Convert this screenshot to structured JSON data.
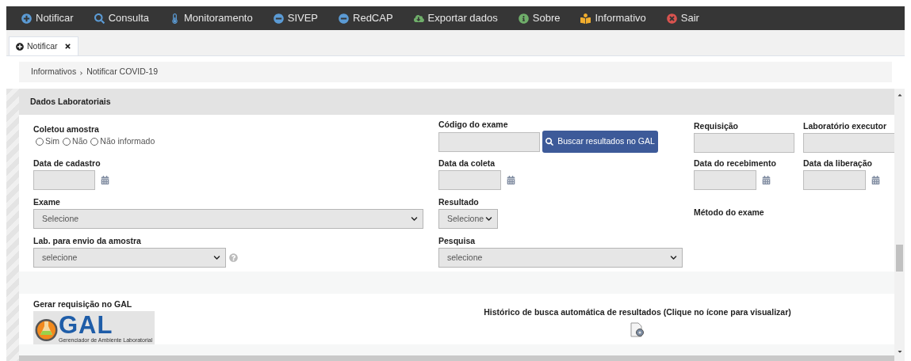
{
  "nav": [
    {
      "label": "Notificar"
    },
    {
      "label": "Consulta"
    },
    {
      "label": "Monitoramento"
    },
    {
      "label": "SIVEP"
    },
    {
      "label": "RedCAP"
    },
    {
      "label": "Exportar dados"
    },
    {
      "label": "Sobre"
    },
    {
      "label": "Informativo"
    },
    {
      "label": "Sair"
    }
  ],
  "tabs": [
    {
      "label": "Notificar",
      "selected": true
    }
  ],
  "breadcrumb": [
    "Informativos",
    "Notificar COVID-19"
  ],
  "section": {
    "title": "Dados Laboratoriais",
    "fields": [
      {
        "kind": "radio",
        "label": "Coletou amostra",
        "options": [
          {
            "label": "Sim",
            "selected": false
          },
          {
            "label": "Não",
            "selected": false
          },
          {
            "label": "Não informado",
            "selected": false
          }
        ]
      },
      {
        "kind": "text_button",
        "label": "Código do exame",
        "button": "Buscar resultados no GAL"
      },
      {
        "kind": "text",
        "label": "Requisição"
      },
      {
        "kind": "text",
        "label": "Laboratório executor"
      },
      {
        "kind": "date",
        "label": "Data de cadastro"
      },
      {
        "kind": "date",
        "label": "Data da coleta"
      },
      {
        "kind": "date",
        "label": "Data do recebimento"
      },
      {
        "kind": "date",
        "label": "Data da liberação"
      },
      {
        "kind": "select",
        "label": "Exame",
        "value": "Selecione"
      },
      {
        "kind": "select",
        "label": "Resultado",
        "value": "Selecione"
      },
      {
        "kind": "label",
        "label": "Método do exame"
      },
      {
        "kind": "blank"
      },
      {
        "kind": "select_help",
        "label": "Lab. para envio da amostra",
        "value": "selecione"
      },
      {
        "kind": "select",
        "label": "Pesquisa",
        "value": "selecione"
      }
    ]
  },
  "gal": {
    "label": "Gerar requisição no GAL",
    "logo_text": "GAL",
    "logo_caption": "Gerenciador de Ambiente Laboratorial"
  },
  "history": {
    "text": "Histórico de busca automática de resultados (Clique no ícone para visualizar)"
  }
}
